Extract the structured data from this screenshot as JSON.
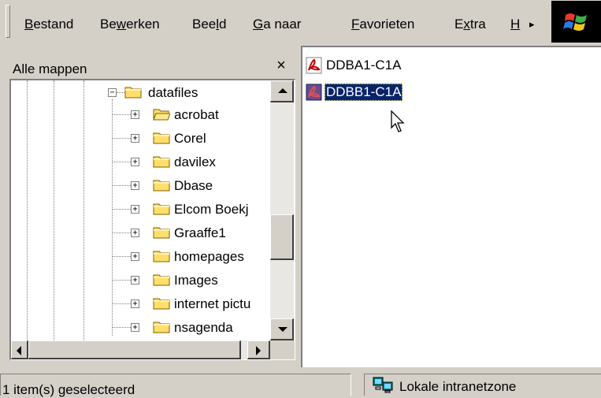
{
  "menubar": {
    "items": [
      {
        "label": "Bestand",
        "accel": "B"
      },
      {
        "label": "Bewerken",
        "accel": "w"
      },
      {
        "label": "Beeld",
        "accel": "l"
      },
      {
        "label": "Ga naar",
        "accel": "G"
      },
      {
        "label": "Favorieten",
        "accel": "F"
      },
      {
        "label": "Extra",
        "accel": "x"
      },
      {
        "label": "H",
        "accel": "H"
      }
    ],
    "overflow_glyph": "▸"
  },
  "folder_pane": {
    "title": "Alle mappen",
    "close_glyph": "×",
    "root": {
      "label": "datafiles",
      "expander": "−"
    },
    "children": [
      {
        "label": "acrobat",
        "expander": "+",
        "open": true
      },
      {
        "label": "Corel",
        "expander": "+"
      },
      {
        "label": "davilex",
        "expander": "+"
      },
      {
        "label": "Dbase",
        "expander": "+"
      },
      {
        "label": "Elcom Boekj",
        "expander": "+"
      },
      {
        "label": "Graaffe1",
        "expander": "+"
      },
      {
        "label": "homepages",
        "expander": "+"
      },
      {
        "label": "Images",
        "expander": "+"
      },
      {
        "label": "internet pictu",
        "expander": "+"
      },
      {
        "label": "nsagenda",
        "expander": "+"
      }
    ]
  },
  "file_pane": {
    "files": [
      {
        "name": "DDBA1-C1A",
        "selected": false
      },
      {
        "name": "DDBB1-C1A",
        "selected": true
      }
    ]
  },
  "statusbar": {
    "selection": "1 item(s) geselecteerd",
    "zone": "Lokale intranetzone"
  },
  "colors": {
    "selection_bg": "#0a246a",
    "folder_yellow": "#ffde6b",
    "pdf_red": "#c00000"
  }
}
